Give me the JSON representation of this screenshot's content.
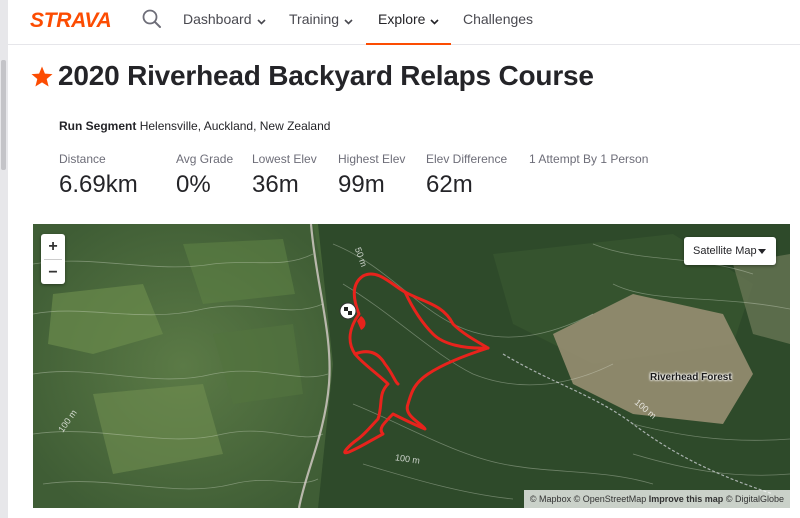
{
  "brand": {
    "logo_text": "STRAVA",
    "accent": "#fc4c02"
  },
  "nav": {
    "search_icon": "search-icon",
    "items": [
      {
        "label": "Dashboard",
        "has_dropdown": true,
        "active": false
      },
      {
        "label": "Training",
        "has_dropdown": true,
        "active": false
      },
      {
        "label": "Explore",
        "has_dropdown": true,
        "active": true
      },
      {
        "label": "Challenges",
        "has_dropdown": false,
        "active": false
      }
    ]
  },
  "segment": {
    "starred": true,
    "title": "2020 Riverhead Backyard Relaps Course",
    "type_label": "Run Segment",
    "location": "Helensville, Auckland, New Zealand"
  },
  "stats": [
    {
      "label": "Distance",
      "value": "6.69km"
    },
    {
      "label": "Avg Grade",
      "value": "0%"
    },
    {
      "label": "Lowest Elev",
      "value": "36m"
    },
    {
      "label": "Highest Elev",
      "value": "99m"
    },
    {
      "label": "Elev Difference",
      "value": "62m"
    }
  ],
  "attempts": "1 Attempt By 1 Person",
  "map": {
    "zoom_in": "+",
    "zoom_out": "−",
    "map_type": "Satellite Map",
    "place_label": "Riverhead Forest",
    "contours": [
      "50 m",
      "100 m",
      "100 m",
      "100 m"
    ],
    "attribution": {
      "mapbox": "© Mapbox",
      "osm": "© OpenStreetMap",
      "improve": "Improve this map",
      "digitalglobe": "© DigitalGlobe"
    },
    "route_color": "#e8231c"
  }
}
